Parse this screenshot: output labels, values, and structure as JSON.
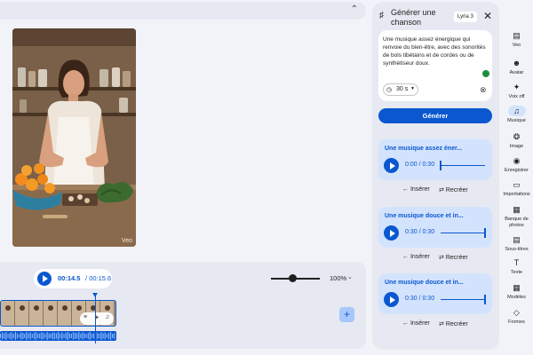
{
  "preview": {
    "watermark": "Veo"
  },
  "timeline": {
    "current_time": "00:14.5",
    "separator": "/",
    "total_time": "00:15.6",
    "zoom": "100%",
    "audio_bar_heights": [
      5,
      8,
      6,
      9,
      4,
      7,
      8,
      5,
      9,
      6,
      4,
      8,
      7,
      5,
      9,
      6,
      8,
      4,
      7,
      9,
      5,
      6,
      8,
      7,
      4,
      9,
      6,
      5,
      8,
      7,
      6,
      9,
      5,
      8,
      4,
      7,
      9,
      6,
      5,
      8,
      7,
      6,
      9,
      5,
      8,
      6,
      4,
      7,
      9,
      5,
      6,
      8,
      7,
      5,
      9,
      6,
      8,
      4,
      7,
      9,
      5,
      6
    ]
  },
  "panel": {
    "title": "Générer une chanson",
    "model": "Lyria 3",
    "prompt": "Une musique assez énergique qui renvoie du bien-être, avec des sonorités de bols tibétains et de cordes ou de synthétiseur doux.",
    "duration": "30 s",
    "generate_label": "Générer",
    "insert_label": "Insérer",
    "recreate_label": "Recréer",
    "tracks": [
      {
        "title": "Une musique assez éner...",
        "time": "0:00 / 0:30",
        "progress": 0.0
      },
      {
        "title": "Une musique douce et in...",
        "time": "0:30 / 0:30",
        "progress": 1.0
      },
      {
        "title": "Une musique douce et in...",
        "time": "0:30 / 0:30",
        "progress": 1.0
      }
    ]
  },
  "rail": {
    "items": [
      {
        "label": "Veo",
        "icon": "film-icon"
      },
      {
        "label": "Avatar",
        "icon": "avatar-icon"
      },
      {
        "label": "Voix off",
        "icon": "voiceover-icon"
      },
      {
        "label": "Musique",
        "icon": "music-icon",
        "active": true
      },
      {
        "label": "Image",
        "icon": "image-icon"
      },
      {
        "label": "Enregistrer",
        "icon": "record-icon"
      },
      {
        "label": "Importations",
        "icon": "folder-icon"
      },
      {
        "label": "Banque de photos",
        "icon": "stock-photo-icon"
      },
      {
        "label": "Sous-titres",
        "icon": "subtitles-icon"
      },
      {
        "label": "Texte",
        "icon": "text-icon"
      },
      {
        "label": "Modèles",
        "icon": "templates-icon"
      },
      {
        "label": "Formes",
        "icon": "shapes-icon"
      }
    ]
  },
  "colors": {
    "accent": "#0b57d0",
    "accent_soft": "#d3e3fd",
    "panel_bg": "#e6e9f1",
    "page_bg": "#f1f3f8"
  }
}
